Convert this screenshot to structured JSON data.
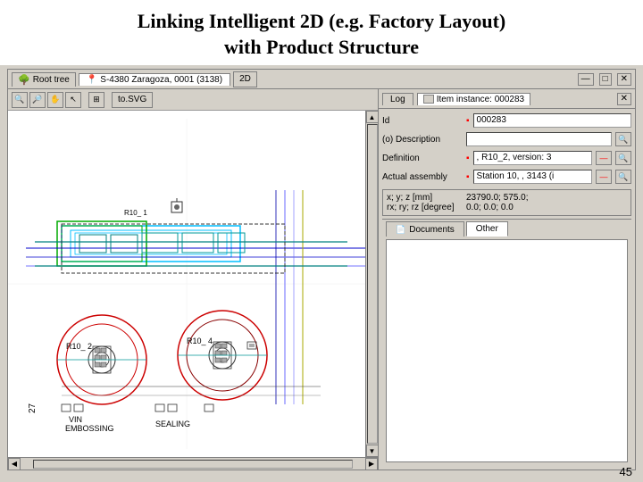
{
  "title": {
    "line1": "Linking Intelligent 2D (e.g. Factory Layout)",
    "line2": "with Product Structure"
  },
  "left_panel": {
    "tree_tab": "Root tree",
    "location_tab": "S-4380 Zaragoza, 0001 (3138)",
    "btn_2d": "2D",
    "toolbar": {
      "tosvg_label": "to.SVG"
    },
    "cad_labels": {
      "r10_1": "R10_ 1",
      "r10_2": "R10_ 2",
      "r10_4": "R10_ 4",
      "vin": "VIN",
      "embossing": "EMBOSSING",
      "sealing": "SEALING",
      "num_27": "27"
    }
  },
  "right_panel": {
    "log_tab": "Log",
    "item_tab": "Item instance: 000283",
    "fields": {
      "id_label": "Id",
      "id_value": "000283",
      "desc_label": "(o) Description",
      "def_label": "Definition",
      "def_value": ", R10_2, version: 3",
      "assembly_label": "Actual assembly",
      "assembly_value": "Station 10, , 3143 (i",
      "coords_label": "x; y; z [mm]",
      "coords_value": "23790.0; 575.0;",
      "rotation_label": "rx; ry; rz [degree]",
      "rotation_value": "0.0; 0.0; 0.0"
    },
    "tabs": {
      "documents_label": "Documents",
      "other_label": "Other"
    }
  },
  "page_number": "45",
  "icons": {
    "tree": "🌿",
    "location": "📍",
    "magnify": "🔍",
    "search": "🔍",
    "red_minus": "—",
    "doc": "📄"
  }
}
